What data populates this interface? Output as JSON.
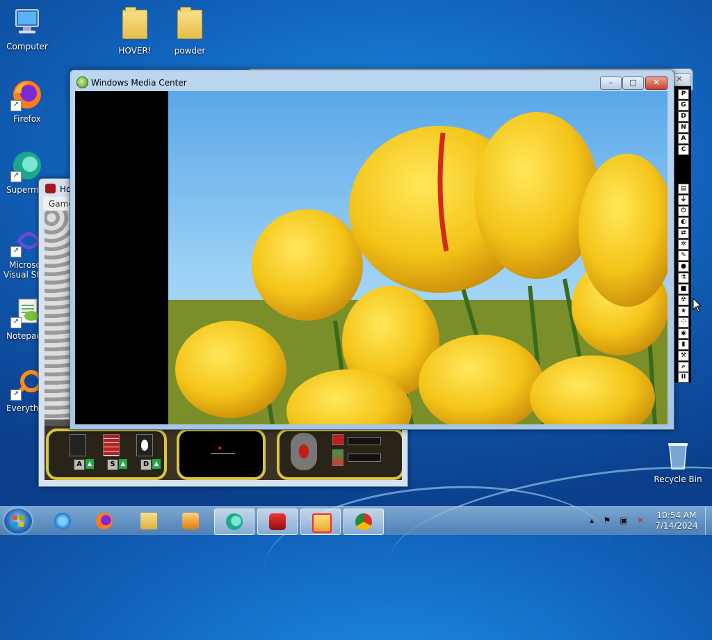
{
  "desktop": {
    "icons": [
      {
        "label": "Computer"
      },
      {
        "label": "HOVER!"
      },
      {
        "label": "powder"
      },
      {
        "label": "Firefox"
      },
      {
        "label": "Supermi"
      },
      {
        "label": "Microso"
      },
      {
        "label": "Visual Stu"
      },
      {
        "label": "Notepad"
      },
      {
        "label": "Everythi"
      },
      {
        "label": "Recycle Bin"
      }
    ]
  },
  "media_center": {
    "title": "Windows Media Center",
    "controls": {
      "minimize": "–",
      "maximize": "□",
      "close": "✕"
    },
    "close_color": "#c7442a"
  },
  "game_window": {
    "title": "Ho",
    "menu": "Game",
    "hud": {
      "keys": [
        "A",
        "S",
        "D"
      ]
    }
  },
  "tool_strip": {
    "letters": [
      "P",
      "G",
      "D",
      "N",
      "A",
      "C"
    ],
    "pause": "II"
  },
  "taskbar": {
    "items": [
      "internet-explorer",
      "firefox",
      "file-explorer",
      "media-player",
      "supermium",
      "hover-game",
      "media-center-thumb",
      "chrome"
    ],
    "clock": {
      "time": "10:54 AM",
      "date": "7/14/2024"
    }
  }
}
